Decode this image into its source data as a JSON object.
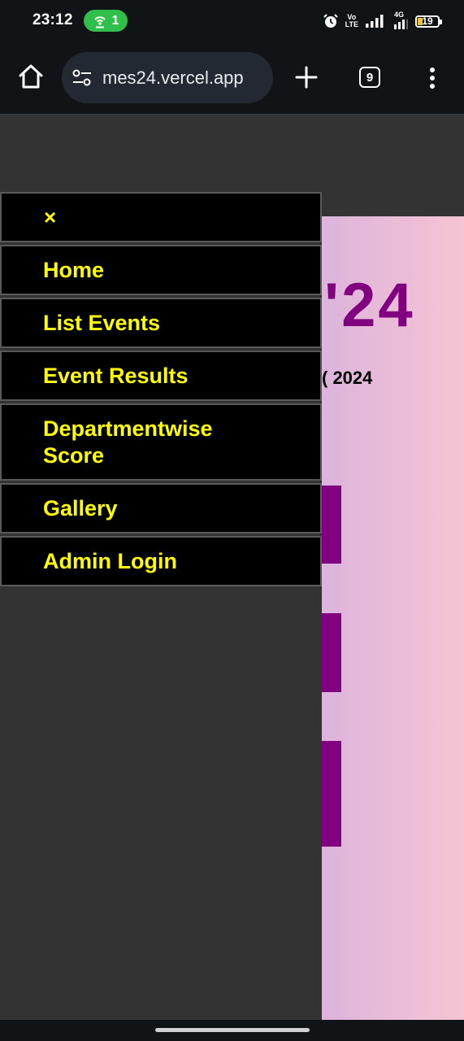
{
  "status_bar": {
    "time": "23:12",
    "hotspot_count": "1",
    "volte_top": "Vo",
    "volte_bottom": "LTE",
    "network_type": "4G",
    "battery": "19"
  },
  "browser": {
    "url": "mes24.vercel.app",
    "tab_count": "9"
  },
  "page": {
    "hero_title": "'24",
    "hero_subtitle": "( 2024",
    "hero_bg_start": "#dcb4dc",
    "hero_bg_end": "#f6c4d2",
    "accent_color": "#800080"
  },
  "sidenav": {
    "close_label": "×",
    "items": [
      {
        "label": "Home"
      },
      {
        "label": "List Events"
      },
      {
        "label": "Event Results"
      },
      {
        "label": "Departmentwise Score"
      },
      {
        "label": "Gallery"
      },
      {
        "label": "Admin Login"
      }
    ],
    "text_color": "#ffff00",
    "item_bg": "#000000"
  }
}
